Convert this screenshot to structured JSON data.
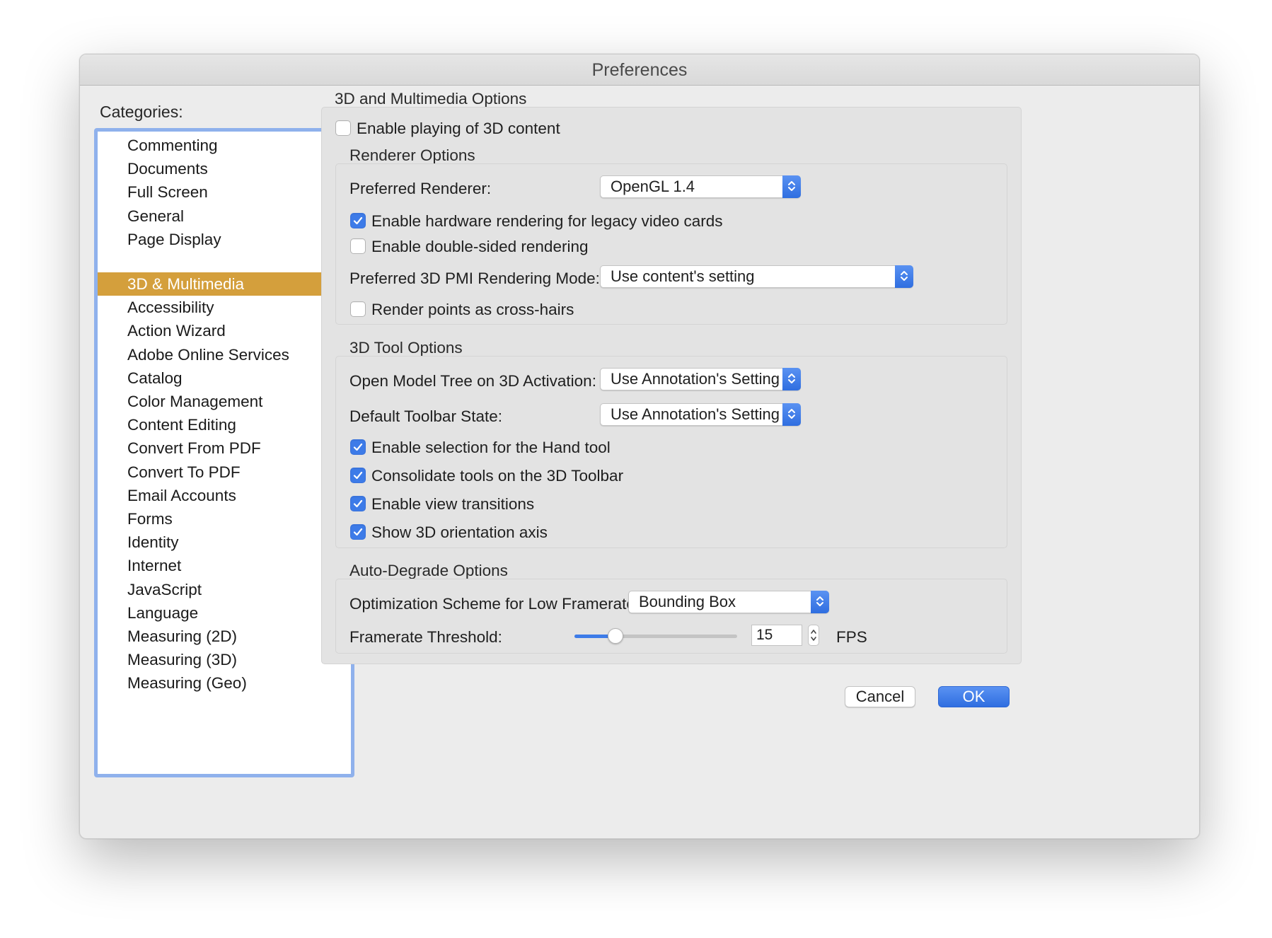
{
  "window": {
    "title": "Preferences"
  },
  "categories": {
    "label": "Categories:",
    "top_items": [
      "Commenting",
      "Documents",
      "Full Screen",
      "General",
      "Page Display"
    ],
    "items": [
      "3D & Multimedia",
      "Accessibility",
      "Action Wizard",
      "Adobe Online Services",
      "Catalog",
      "Color Management",
      "Content Editing",
      "Convert From PDF",
      "Convert To PDF",
      "Email Accounts",
      "Forms",
      "Identity",
      "Internet",
      "JavaScript",
      "Language",
      "Measuring (2D)",
      "Measuring (3D)",
      "Measuring (Geo)"
    ],
    "selected": "3D & Multimedia"
  },
  "main": {
    "section_title": "3D and Multimedia Options",
    "enable_3d": {
      "label": "Enable playing of 3D content",
      "checked": false
    },
    "renderer": {
      "title": "Renderer Options",
      "preferred_renderer_label": "Preferred Renderer:",
      "preferred_renderer_value": "OpenGL 1.4",
      "hw_legacy": {
        "label": "Enable hardware rendering for legacy video cards",
        "checked": true
      },
      "double_sided": {
        "label": "Enable double-sided rendering",
        "checked": false
      },
      "pmi_label": "Preferred 3D PMI Rendering Mode:",
      "pmi_value": "Use content's setting",
      "cross_hairs": {
        "label": "Render points as cross-hairs",
        "checked": false
      }
    },
    "tool": {
      "title": "3D Tool Options",
      "model_tree_label": "Open Model Tree on 3D Activation:",
      "model_tree_value": "Use Annotation's Setting",
      "toolbar_state_label": "Default Toolbar State:",
      "toolbar_state_value": "Use Annotation's Setting",
      "hand_tool": {
        "label": "Enable selection for the Hand tool",
        "checked": true
      },
      "consolidate": {
        "label": "Consolidate tools on the 3D Toolbar",
        "checked": true
      },
      "view_transitions": {
        "label": "Enable view transitions",
        "checked": true
      },
      "orientation_axis": {
        "label": "Show 3D orientation axis",
        "checked": true
      }
    },
    "degrade": {
      "title": "Auto-Degrade Options",
      "scheme_label": "Optimization Scheme for Low Framerate:",
      "scheme_value": "Bounding Box",
      "threshold_label": "Framerate Threshold:",
      "threshold_value": "15",
      "threshold_fraction": 0.25,
      "threshold_unit": "FPS"
    }
  },
  "buttons": {
    "cancel": "Cancel",
    "ok": "OK"
  },
  "colors": {
    "accent": "#3d7be8",
    "selection": "#d49f3c",
    "list_border": "#8fb1ec"
  }
}
